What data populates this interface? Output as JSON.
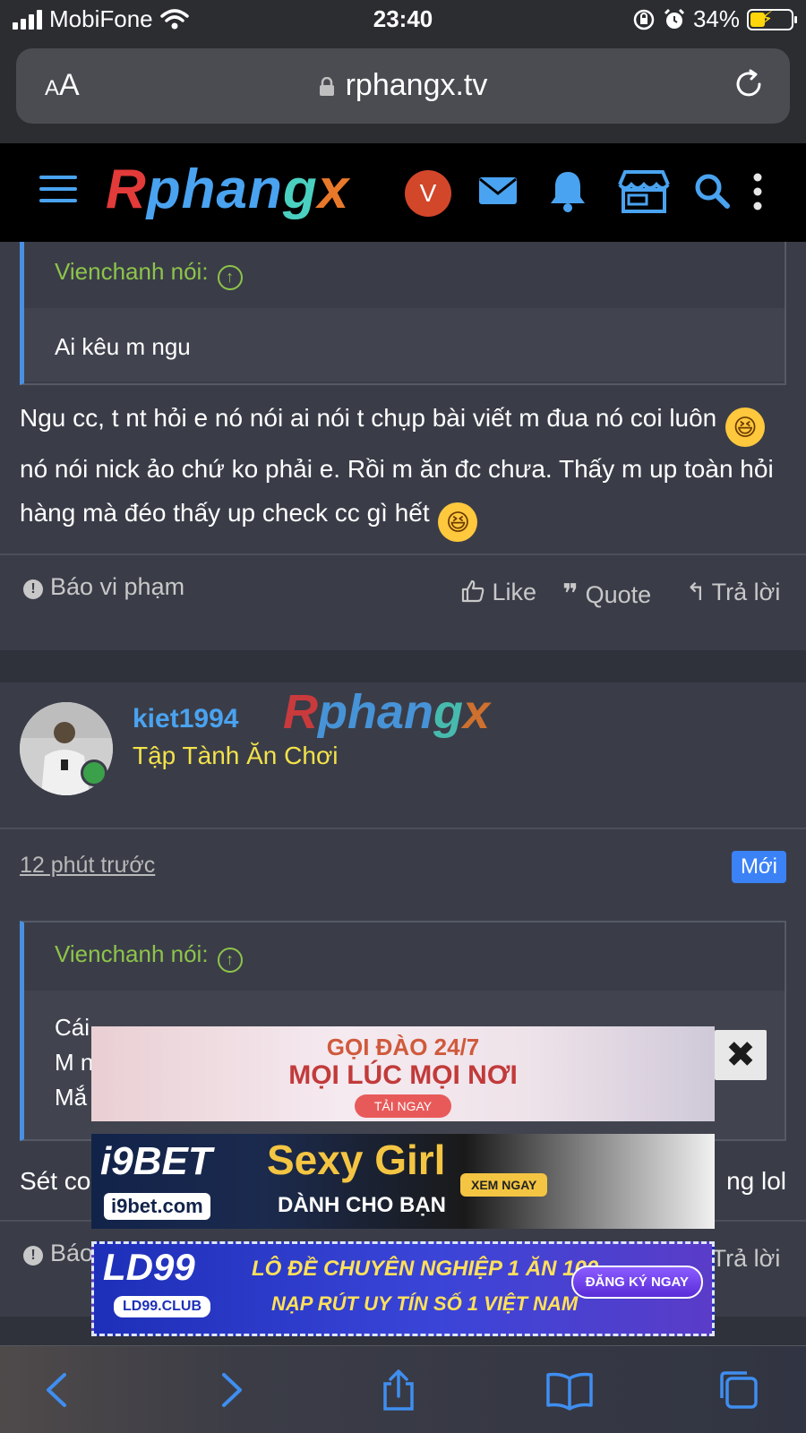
{
  "status_bar": {
    "carrier": "MobiFone",
    "time": "23:40",
    "battery_percent": "34%"
  },
  "browser": {
    "aa_small": "A",
    "aa_large": "A",
    "url": "rphangx.tv"
  },
  "header": {
    "logo_parts": [
      "R",
      "phan",
      "g",
      "x"
    ],
    "user_initial": "V"
  },
  "post1": {
    "quote_author": "Vienchanh nói:",
    "quote_text": "Ai kêu m ngu",
    "message_part1": "Ngu cc, t nt hỏi e nó nói ai nói t chụp bài viết m đua nó coi luôn ",
    "message_part2": "nó nói nick ảo chứ ko phải e. Rồi m ăn đc chưa. Thấy m up toàn hỏi hàng mà đéo thấy up check cc gì hết ",
    "emoji": "😆",
    "report_label": "Báo vi phạm",
    "like_label": "Like",
    "quote_label": "Quote",
    "reply_label": "Trả lời"
  },
  "post2": {
    "username": "kiet1994",
    "user_title": "Tập Tành Ăn Chơi",
    "timestamp": "12 phút trước",
    "badge": "Mới",
    "quote_author": "Vienchanh nói:",
    "quote_line1": "Cái",
    "quote_line2": "M n",
    "quote_line3": "Mắ",
    "message_start": "Sét co",
    "message_end": "ng lol",
    "report_label": "Báo",
    "reply_label": "Trả lời"
  },
  "ads": {
    "ad1_line1": "GỌI ĐÀO 24/7",
    "ad1_line2": "MỌI LÚC MỌI NƠI",
    "ad1_button": "TẢI NGAY",
    "ad2_brand": "i9BET",
    "ad2_domain": "i9bet.com",
    "ad2_headline": "Sexy Girl",
    "ad2_sub": "DÀNH CHO BẠN",
    "ad2_button": "XEM NGAY",
    "ad3_brand": "LD99",
    "ad3_club": "LD99.CLUB",
    "ad3_line1": "LÔ ĐỀ CHUYÊN NGHIỆP 1 ĂN 100",
    "ad3_line2": "NẠP RÚT UY TÍN SỐ 1 VIỆT NAM",
    "ad3_button": "ĐĂNG KÝ NGAY",
    "close_symbol": "✖"
  },
  "icons": {
    "header": [
      "menu-icon",
      "mail-icon",
      "bell-icon",
      "store-icon",
      "search-icon",
      "more-vertical-icon"
    ],
    "toolbar": [
      "back-icon",
      "forward-icon",
      "share-icon",
      "bookmarks-icon",
      "tabs-icon"
    ]
  },
  "colors": {
    "accent_blue": "#4aa3f0",
    "quote_green": "#8ec44a",
    "title_yellow": "#f3e24a",
    "badge_blue": "#3b82f6",
    "avatar_orange": "#d2462a"
  }
}
